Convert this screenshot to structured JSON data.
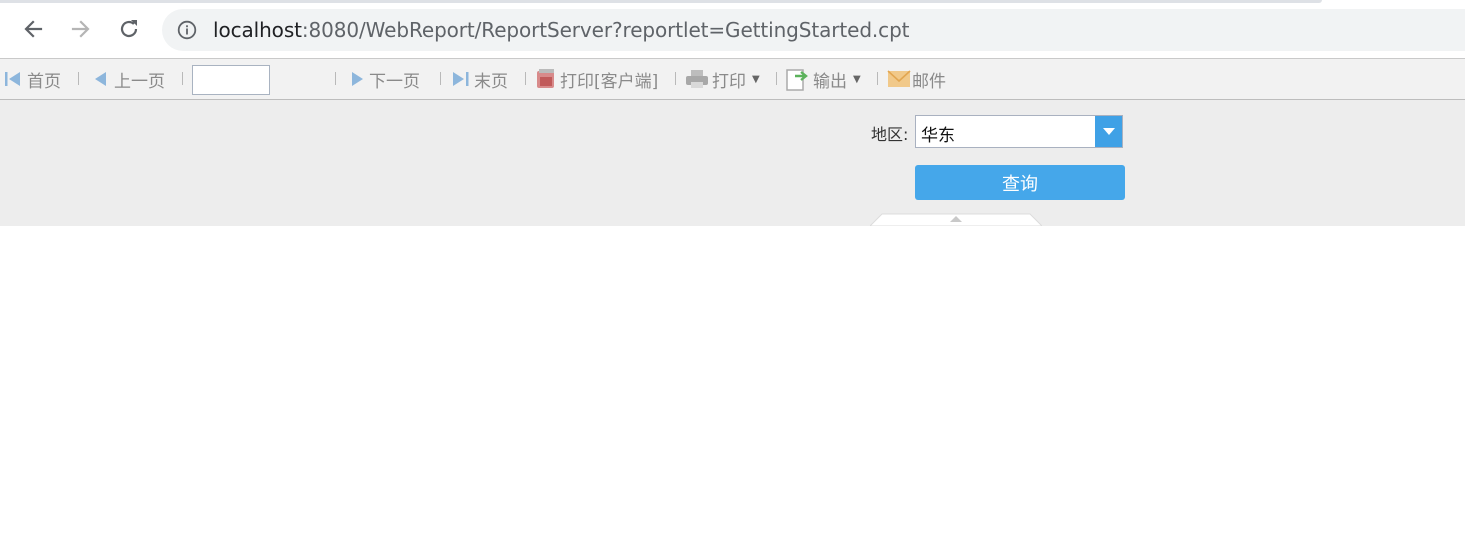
{
  "browser": {
    "url_host": "localhost",
    "url_path": ":8080/WebReport/ReportServer?reportlet=GettingStarted.cpt",
    "back_icon": "arrow-left-icon",
    "forward_icon": "arrow-right-icon",
    "reload_icon": "reload-icon",
    "site_info_icon": "info-icon"
  },
  "toolbar": {
    "first_label": "首页",
    "prev_label": "上一页",
    "page_value": "",
    "next_label": "下一页",
    "last_label": "末页",
    "print_client_label": "打印[客户端]",
    "print_label": "打印",
    "export_label": "输出",
    "email_label": "邮件"
  },
  "params": {
    "region_label": "地区:",
    "region_value": "华东",
    "query_label": "查询"
  },
  "colors": {
    "accent": "#45a7ea",
    "combo_trigger": "#3fa1e6"
  }
}
